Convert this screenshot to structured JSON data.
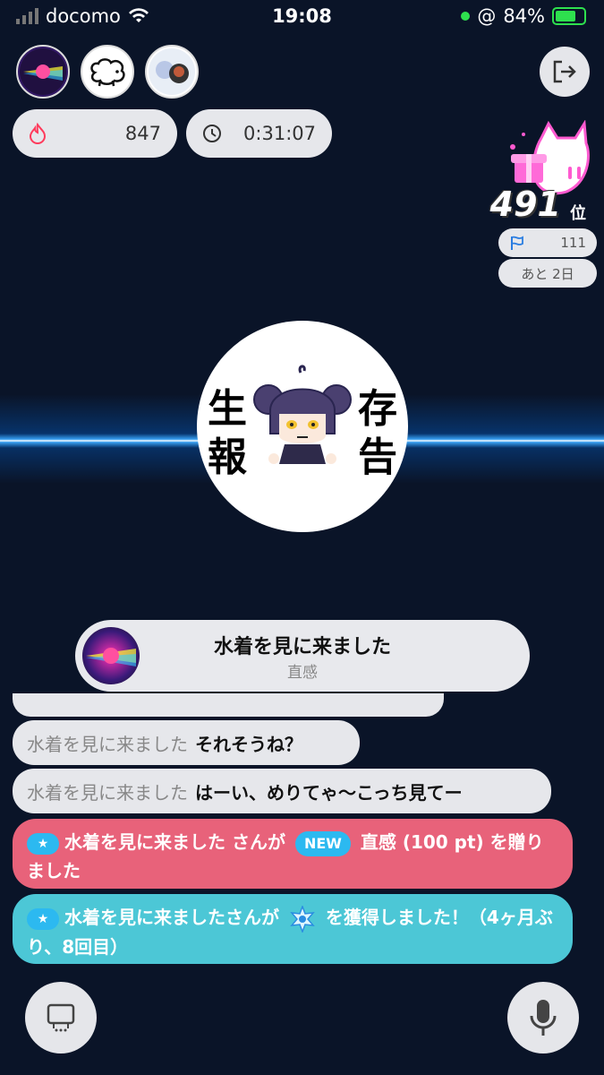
{
  "status_bar": {
    "carrier": "docomo",
    "time": "19:08",
    "battery_percent": "84%"
  },
  "header": {
    "points": "847",
    "timer": "0:31:07"
  },
  "ranking": {
    "rank": "491",
    "rank_unit": "位",
    "flag_count": "111",
    "days_left": "あと 2日"
  },
  "center_logo": {
    "chars": [
      "生",
      "報",
      "存",
      "告"
    ]
  },
  "notice": {
    "title": "水着を見に来ました",
    "subtitle": "直感"
  },
  "chat": [
    {
      "name": "水着を見に来ました",
      "message": "それそうね？"
    },
    {
      "name": "水着を見に来ました",
      "message": "はーい、めりてゃ〜こっち見てー"
    }
  ],
  "system_messages": {
    "gift": {
      "name": "水着を見に来ました",
      "text1": " さんが ",
      "badge": "NEW",
      "text2": " 直感 (100 pt) を贈りました",
      "color": "#e8627a"
    },
    "medal": {
      "name": "水着を見に来ました",
      "text1": "さんが ",
      "text2": " を獲得しました！（4ヶ月ぶり、8回目）",
      "color": "#4cc7d6"
    }
  },
  "icons": {
    "star_badge": "★"
  }
}
